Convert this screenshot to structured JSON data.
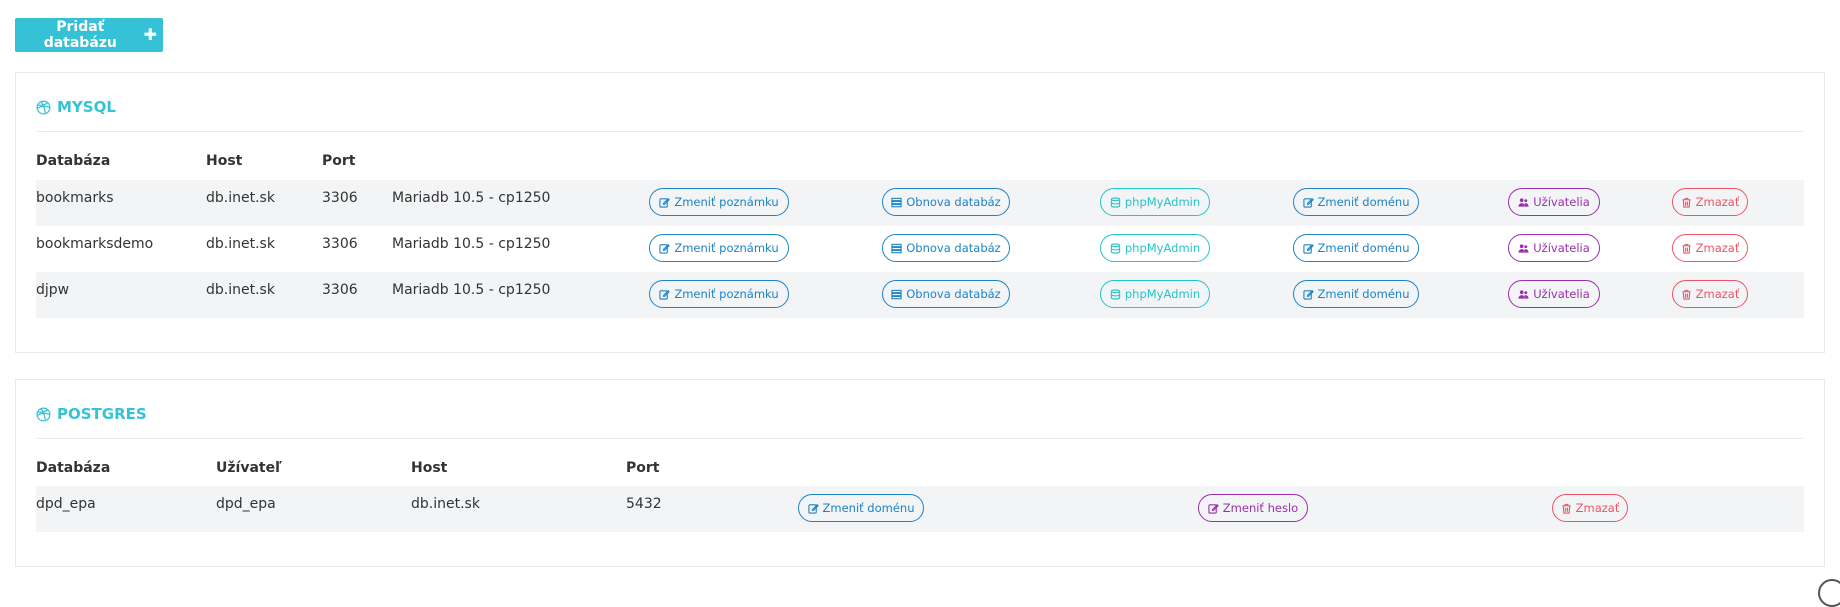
{
  "add_button": {
    "label": "Pridať databázu",
    "icon": "plus-icon"
  },
  "mysql": {
    "title": "MYSQL",
    "icon": "dribbble-icon",
    "headers": {
      "database": "Databáza",
      "host": "Host",
      "port": "Port"
    },
    "actions": {
      "note": "Zmeniť poznámku",
      "restore": "Obnova databáz",
      "pma": "phpMyAdmin",
      "domain": "Zmeniť doménu",
      "users": "Užívatelia",
      "delete": "Zmazať"
    },
    "rows": [
      {
        "database": "bookmarks",
        "host": "db.inet.sk",
        "port": "3306",
        "version": "Mariadb 10.5 - cp1250"
      },
      {
        "database": "bookmarksdemo",
        "host": "db.inet.sk",
        "port": "3306",
        "version": "Mariadb 10.5 - cp1250"
      },
      {
        "database": "djpw",
        "host": "db.inet.sk",
        "port": "3306",
        "version": "Mariadb 10.5 - cp1250"
      }
    ]
  },
  "postgres": {
    "title": "POSTGRES",
    "icon": "dribbble-icon",
    "headers": {
      "database": "Databáza",
      "user": "Užívateľ",
      "host": "Host",
      "port": "Port"
    },
    "actions": {
      "domain": "Zmeniť doménu",
      "password": "Zmeniť heslo",
      "delete": "Zmazať"
    },
    "rows": [
      {
        "database": "dpd_epa",
        "user": "dpd_epa",
        "host": "db.inet.sk",
        "port": "5432"
      }
    ]
  },
  "colors": {
    "accent": "#35c2d6",
    "blue": "#1c84c6",
    "cyan": "#23c6c8",
    "purple": "#9b2fae",
    "red": "#ed5565"
  }
}
